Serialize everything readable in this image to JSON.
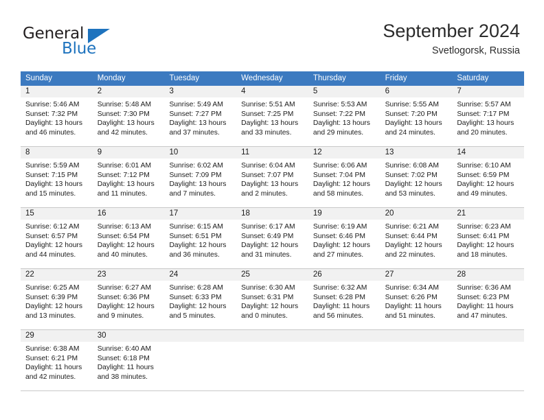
{
  "brand": {
    "name_top": "General",
    "name_bottom": "Blue",
    "triangle_icon": "blue-triangle-icon",
    "color_dark": "#231f20",
    "color_blue": "#1e73be"
  },
  "header": {
    "title": "September 2024",
    "subtitle": "Svetlogorsk, Russia"
  },
  "theme": {
    "header_blue": "#3c7ac0",
    "daynum_band": "#f1f1f1",
    "row_border": "#c8c8c8"
  },
  "weekdays": [
    "Sunday",
    "Monday",
    "Tuesday",
    "Wednesday",
    "Thursday",
    "Friday",
    "Saturday"
  ],
  "weeks": [
    [
      {
        "day": "1",
        "sunrise": "Sunrise: 5:46 AM",
        "sunset": "Sunset: 7:32 PM",
        "daylight1": "Daylight: 13 hours",
        "daylight2": "and 46 minutes."
      },
      {
        "day": "2",
        "sunrise": "Sunrise: 5:48 AM",
        "sunset": "Sunset: 7:30 PM",
        "daylight1": "Daylight: 13 hours",
        "daylight2": "and 42 minutes."
      },
      {
        "day": "3",
        "sunrise": "Sunrise: 5:49 AM",
        "sunset": "Sunset: 7:27 PM",
        "daylight1": "Daylight: 13 hours",
        "daylight2": "and 37 minutes."
      },
      {
        "day": "4",
        "sunrise": "Sunrise: 5:51 AM",
        "sunset": "Sunset: 7:25 PM",
        "daylight1": "Daylight: 13 hours",
        "daylight2": "and 33 minutes."
      },
      {
        "day": "5",
        "sunrise": "Sunrise: 5:53 AM",
        "sunset": "Sunset: 7:22 PM",
        "daylight1": "Daylight: 13 hours",
        "daylight2": "and 29 minutes."
      },
      {
        "day": "6",
        "sunrise": "Sunrise: 5:55 AM",
        "sunset": "Sunset: 7:20 PM",
        "daylight1": "Daylight: 13 hours",
        "daylight2": "and 24 minutes."
      },
      {
        "day": "7",
        "sunrise": "Sunrise: 5:57 AM",
        "sunset": "Sunset: 7:17 PM",
        "daylight1": "Daylight: 13 hours",
        "daylight2": "and 20 minutes."
      }
    ],
    [
      {
        "day": "8",
        "sunrise": "Sunrise: 5:59 AM",
        "sunset": "Sunset: 7:15 PM",
        "daylight1": "Daylight: 13 hours",
        "daylight2": "and 15 minutes."
      },
      {
        "day": "9",
        "sunrise": "Sunrise: 6:01 AM",
        "sunset": "Sunset: 7:12 PM",
        "daylight1": "Daylight: 13 hours",
        "daylight2": "and 11 minutes."
      },
      {
        "day": "10",
        "sunrise": "Sunrise: 6:02 AM",
        "sunset": "Sunset: 7:09 PM",
        "daylight1": "Daylight: 13 hours",
        "daylight2": "and 7 minutes."
      },
      {
        "day": "11",
        "sunrise": "Sunrise: 6:04 AM",
        "sunset": "Sunset: 7:07 PM",
        "daylight1": "Daylight: 13 hours",
        "daylight2": "and 2 minutes."
      },
      {
        "day": "12",
        "sunrise": "Sunrise: 6:06 AM",
        "sunset": "Sunset: 7:04 PM",
        "daylight1": "Daylight: 12 hours",
        "daylight2": "and 58 minutes."
      },
      {
        "day": "13",
        "sunrise": "Sunrise: 6:08 AM",
        "sunset": "Sunset: 7:02 PM",
        "daylight1": "Daylight: 12 hours",
        "daylight2": "and 53 minutes."
      },
      {
        "day": "14",
        "sunrise": "Sunrise: 6:10 AM",
        "sunset": "Sunset: 6:59 PM",
        "daylight1": "Daylight: 12 hours",
        "daylight2": "and 49 minutes."
      }
    ],
    [
      {
        "day": "15",
        "sunrise": "Sunrise: 6:12 AM",
        "sunset": "Sunset: 6:57 PM",
        "daylight1": "Daylight: 12 hours",
        "daylight2": "and 44 minutes."
      },
      {
        "day": "16",
        "sunrise": "Sunrise: 6:13 AM",
        "sunset": "Sunset: 6:54 PM",
        "daylight1": "Daylight: 12 hours",
        "daylight2": "and 40 minutes."
      },
      {
        "day": "17",
        "sunrise": "Sunrise: 6:15 AM",
        "sunset": "Sunset: 6:51 PM",
        "daylight1": "Daylight: 12 hours",
        "daylight2": "and 36 minutes."
      },
      {
        "day": "18",
        "sunrise": "Sunrise: 6:17 AM",
        "sunset": "Sunset: 6:49 PM",
        "daylight1": "Daylight: 12 hours",
        "daylight2": "and 31 minutes."
      },
      {
        "day": "19",
        "sunrise": "Sunrise: 6:19 AM",
        "sunset": "Sunset: 6:46 PM",
        "daylight1": "Daylight: 12 hours",
        "daylight2": "and 27 minutes."
      },
      {
        "day": "20",
        "sunrise": "Sunrise: 6:21 AM",
        "sunset": "Sunset: 6:44 PM",
        "daylight1": "Daylight: 12 hours",
        "daylight2": "and 22 minutes."
      },
      {
        "day": "21",
        "sunrise": "Sunrise: 6:23 AM",
        "sunset": "Sunset: 6:41 PM",
        "daylight1": "Daylight: 12 hours",
        "daylight2": "and 18 minutes."
      }
    ],
    [
      {
        "day": "22",
        "sunrise": "Sunrise: 6:25 AM",
        "sunset": "Sunset: 6:39 PM",
        "daylight1": "Daylight: 12 hours",
        "daylight2": "and 13 minutes."
      },
      {
        "day": "23",
        "sunrise": "Sunrise: 6:27 AM",
        "sunset": "Sunset: 6:36 PM",
        "daylight1": "Daylight: 12 hours",
        "daylight2": "and 9 minutes."
      },
      {
        "day": "24",
        "sunrise": "Sunrise: 6:28 AM",
        "sunset": "Sunset: 6:33 PM",
        "daylight1": "Daylight: 12 hours",
        "daylight2": "and 5 minutes."
      },
      {
        "day": "25",
        "sunrise": "Sunrise: 6:30 AM",
        "sunset": "Sunset: 6:31 PM",
        "daylight1": "Daylight: 12 hours",
        "daylight2": "and 0 minutes."
      },
      {
        "day": "26",
        "sunrise": "Sunrise: 6:32 AM",
        "sunset": "Sunset: 6:28 PM",
        "daylight1": "Daylight: 11 hours",
        "daylight2": "and 56 minutes."
      },
      {
        "day": "27",
        "sunrise": "Sunrise: 6:34 AM",
        "sunset": "Sunset: 6:26 PM",
        "daylight1": "Daylight: 11 hours",
        "daylight2": "and 51 minutes."
      },
      {
        "day": "28",
        "sunrise": "Sunrise: 6:36 AM",
        "sunset": "Sunset: 6:23 PM",
        "daylight1": "Daylight: 11 hours",
        "daylight2": "and 47 minutes."
      }
    ],
    [
      {
        "day": "29",
        "sunrise": "Sunrise: 6:38 AM",
        "sunset": "Sunset: 6:21 PM",
        "daylight1": "Daylight: 11 hours",
        "daylight2": "and 42 minutes."
      },
      {
        "day": "30",
        "sunrise": "Sunrise: 6:40 AM",
        "sunset": "Sunset: 6:18 PM",
        "daylight1": "Daylight: 11 hours",
        "daylight2": "and 38 minutes."
      },
      {
        "day": "",
        "sunrise": "",
        "sunset": "",
        "daylight1": "",
        "daylight2": ""
      },
      {
        "day": "",
        "sunrise": "",
        "sunset": "",
        "daylight1": "",
        "daylight2": ""
      },
      {
        "day": "",
        "sunrise": "",
        "sunset": "",
        "daylight1": "",
        "daylight2": ""
      },
      {
        "day": "",
        "sunrise": "",
        "sunset": "",
        "daylight1": "",
        "daylight2": ""
      },
      {
        "day": "",
        "sunrise": "",
        "sunset": "",
        "daylight1": "",
        "daylight2": ""
      }
    ]
  ]
}
